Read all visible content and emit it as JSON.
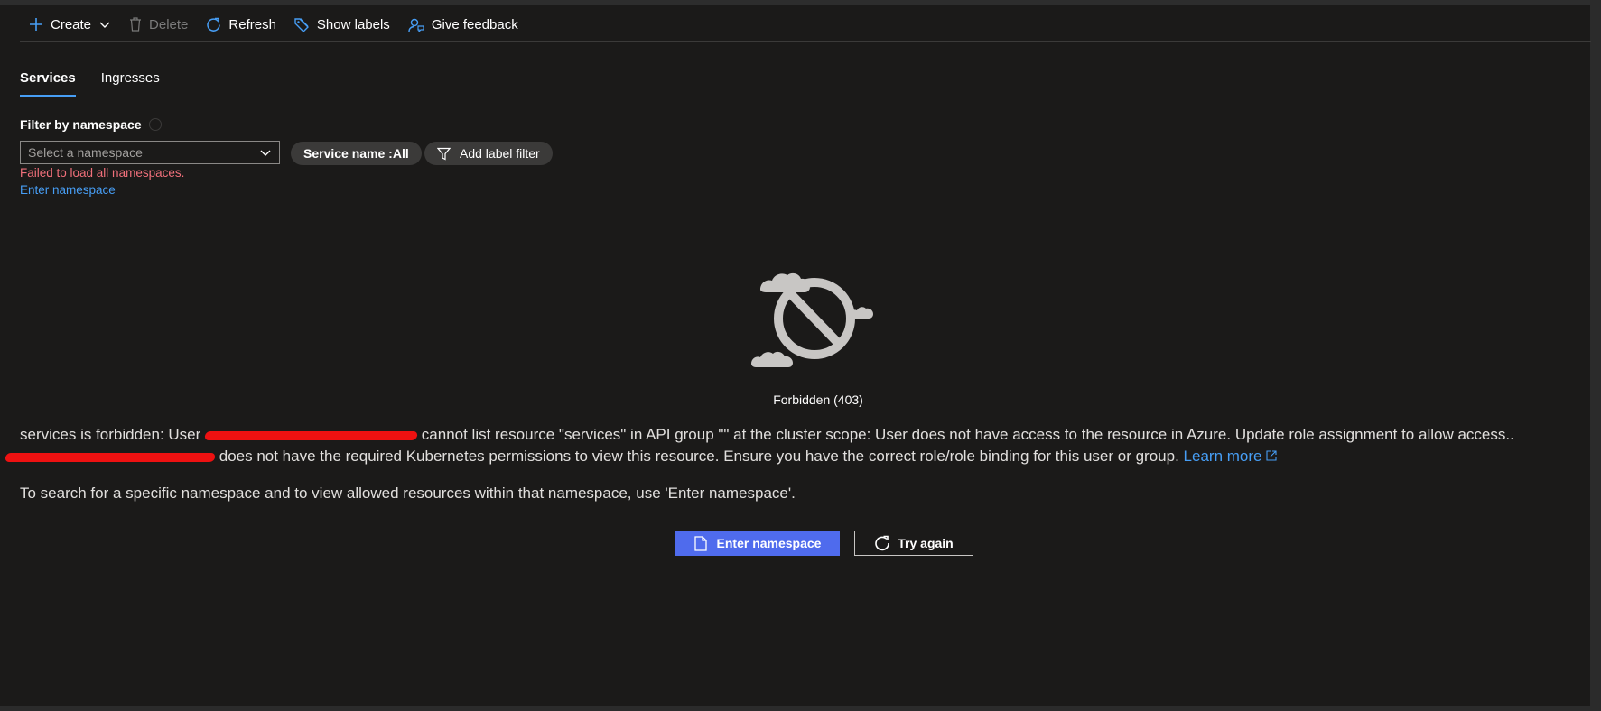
{
  "toolbar": {
    "create": "Create",
    "delete": "Delete",
    "refresh": "Refresh",
    "show_labels": "Show labels",
    "feedback": "Give feedback"
  },
  "tabs": [
    {
      "label": "Services",
      "active": true
    },
    {
      "label": "Ingresses",
      "active": false
    }
  ],
  "filter": {
    "label": "Filter by namespace",
    "placeholder": "Select a namespace",
    "error": "Failed to load all namespaces.",
    "enter_namespace_link": "Enter namespace",
    "service_name_prefix": "Service name : ",
    "service_name_value": "All",
    "add_label_filter": "Add label filter"
  },
  "error_state": {
    "title": "Forbidden (403)",
    "line1_a": "services is forbidden: User",
    "line1_b": "cannot list resource \"services\" in API group \"\" at the cluster scope: User does not have access to the resource in Azure. Update role assignment to allow access..",
    "line2": "does not have the required Kubernetes permissions to view this resource. Ensure you have the correct role/role binding for this user or group.",
    "learn_more": "Learn more",
    "line3": "To search for a specific namespace and to view allowed resources within that namespace, use 'Enter namespace'.",
    "primary_button": "Enter namespace",
    "secondary_button": "Try again"
  },
  "colors": {
    "background": "#1b1a19",
    "accent": "#4f6bed",
    "link": "#479ef5",
    "error": "#f1707b"
  }
}
